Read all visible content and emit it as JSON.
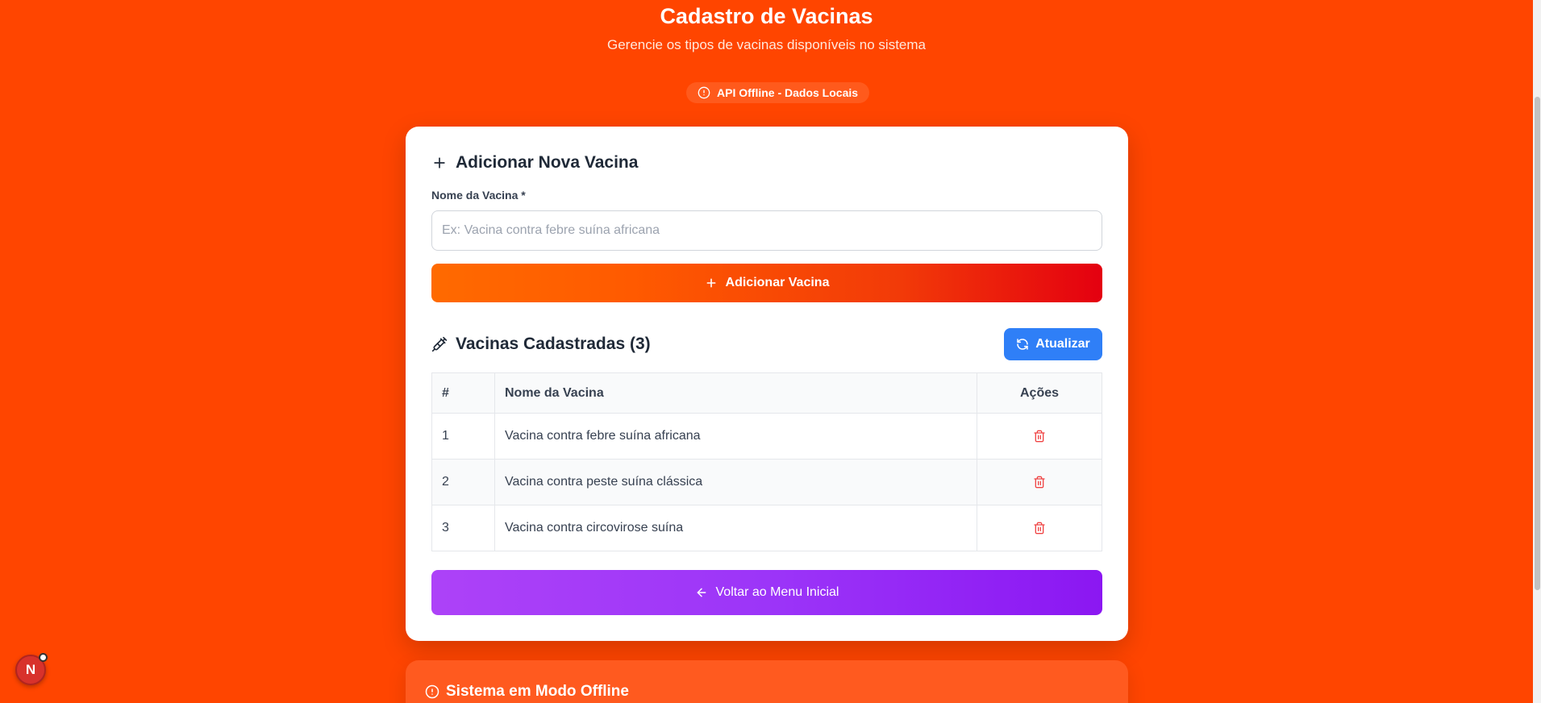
{
  "header": {
    "title": "Cadastro de Vacinas",
    "subtitle": "Gerencie os tipos de vacinas disponíveis no sistema"
  },
  "status": {
    "label": "API Offline - Dados Locais",
    "icon": "alert-circle-icon"
  },
  "form": {
    "title": "Adicionar Nova Vacina",
    "name_label": "Nome da Vacina *",
    "name_placeholder": "Ex: Vacina contra febre suína africana",
    "name_value": "",
    "submit_label": "Adicionar Vacina"
  },
  "list": {
    "title": "Vacinas Cadastradas (3)",
    "refresh_label": "Atualizar",
    "columns": [
      "#",
      "Nome da Vacina",
      "Ações"
    ],
    "rows": [
      {
        "id": "1",
        "name": "Vacina contra febre suína africana"
      },
      {
        "id": "2",
        "name": "Vacina contra peste suína clássica"
      },
      {
        "id": "3",
        "name": "Vacina contra circovirose suína"
      }
    ]
  },
  "back_label": "Voltar ao Menu Inicial",
  "offline_panel": {
    "title": "Sistema em Modo Offline"
  },
  "dev_badge": "N",
  "colors": {
    "background": "#ff4500",
    "accent_blue": "#2f7ff7",
    "delete_red": "#ef4444",
    "purple": "#9c35f8"
  }
}
